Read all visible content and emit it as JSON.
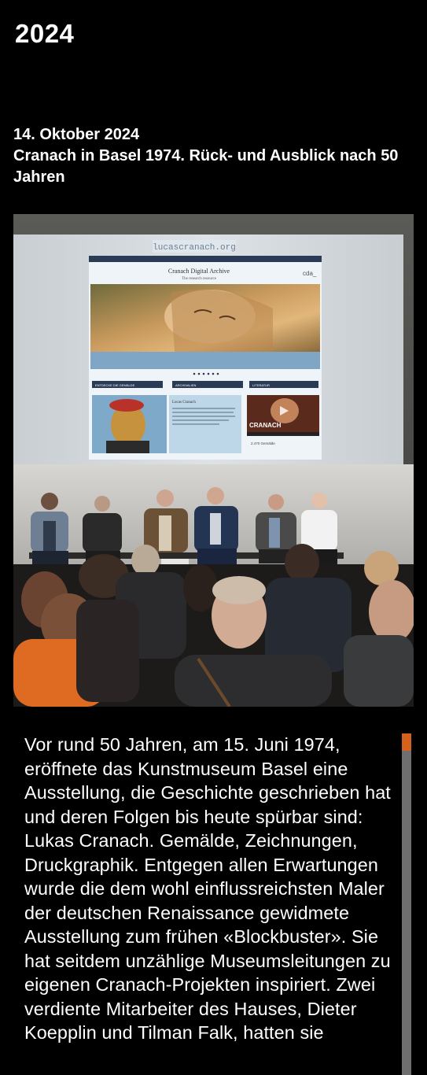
{
  "page": {
    "year": "2024"
  },
  "event": {
    "date": "14. Oktober 2024",
    "title": "Cranach in Basel 1974. Rück- und Ausblick nach 50 Jahren"
  },
  "photo": {
    "projected_site": {
      "banner": "lucascranach.org",
      "header_title": "Cranach Digital Archive",
      "header_subtitle": "The research resource",
      "logo": "cda_",
      "section_one": "ENTDECKE DIE GEMÄLDE",
      "section_two": "ARCHIVALIEN",
      "section_three": "LITERATUR",
      "card_title": "Lucas Cranach",
      "video_label": "CRANACH",
      "count_label": "2.470 Gemälde"
    }
  },
  "article": {
    "text": "Vor rund 50 Jahren, am 15. Juni 1974, eröffnete das Kunstmuseum Basel eine Ausstellung, die Geschichte geschrieben hat und deren Folgen bis heute spürbar sind: Lukas Cranach. Gemälde, Zeichnungen, Druckgraphik. Entgegen allen Erwartungen wurde die dem wohl einflussreichsten Maler der deutschen Renaissance gewidmete Ausstellung zum frühen «Blockbuster». Sie hat seitdem unzählige Museumsleitungen zu eigenen Cranach-Projekten inspiriert. Zwei verdiente Mitarbeiter des Hauses, Dieter Koepplin und Tilman Falk, hatten sie"
  },
  "scrollbar": {
    "accent_color": "#d4611c",
    "track_color": "#6f6f6f",
    "position": 0.0
  }
}
